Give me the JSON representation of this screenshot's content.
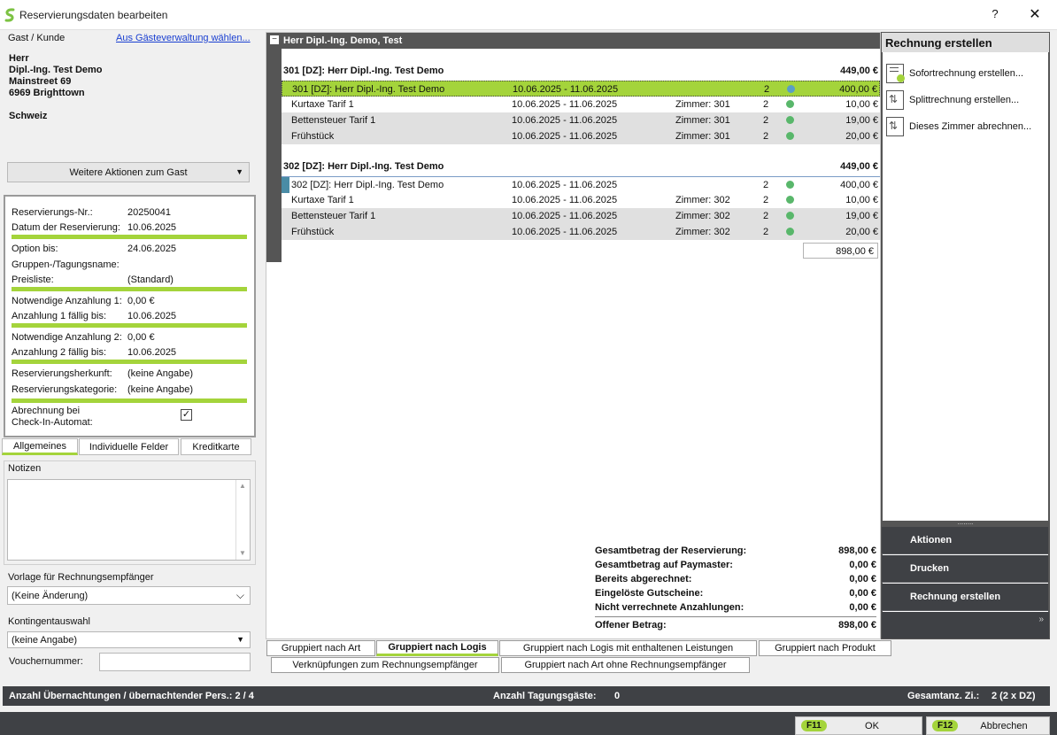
{
  "window": {
    "title": "Reservierungsdaten bearbeiten",
    "help": "?",
    "close": "✕"
  },
  "guest": {
    "section_label": "Gast / Kunde",
    "choose_link": "Aus Gästeverwaltung wählen...",
    "salutation": "Herr",
    "name": "Dipl.-Ing. Test Demo",
    "street": "Mainstreet 69",
    "city": "6969 Brighttown",
    "country": "Schweiz",
    "actions_button": "Weitere Aktionen zum Gast"
  },
  "reservation": {
    "fields": [
      {
        "label": "Reservierungs-Nr.:",
        "value": "20250041"
      },
      {
        "label": "Datum der Reservierung:",
        "value": "10.06.2025"
      },
      {
        "label": "Option bis:",
        "value": "24.06.2025"
      },
      {
        "label": "Gruppen-/Tagungsname:",
        "value": ""
      },
      {
        "label": "Preisliste:",
        "value": "(Standard)"
      },
      {
        "label": "Notwendige Anzahlung 1:",
        "value": "0,00 €"
      },
      {
        "label": "Anzahlung 1 fällig bis:",
        "value": "10.06.2025"
      },
      {
        "label": "Notwendige Anzahlung 2:",
        "value": "0,00 €"
      },
      {
        "label": "Anzahlung 2 fällig bis:",
        "value": "10.06.2025"
      },
      {
        "label": "Reservierungsherkunft:",
        "value": "(keine Angabe)"
      },
      {
        "label": "Reservierungskategorie:",
        "value": "(keine Angabe)"
      }
    ],
    "checkin_label_1": "Abrechnung bei",
    "checkin_label_2": "Check-In-Automat:",
    "checkin_checked": true
  },
  "left_tabs": [
    "Allgemeines",
    "Individuelle Felder",
    "Kreditkarte"
  ],
  "notes": {
    "label": "Notizen",
    "value": ""
  },
  "invoice_template": {
    "label": "Vorlage für Rechnungsempfänger",
    "value": "(Keine Änderung)"
  },
  "quota": {
    "label": "Kontingentauswahl",
    "value": "(keine Angabe)"
  },
  "voucher": {
    "label": "Vouchernummer:",
    "value": ""
  },
  "main": {
    "header": "Herr Dipl.-Ing. Demo, Test",
    "groups": [
      {
        "title": "301 [DZ]: Herr Dipl.-Ing. Test Demo",
        "total": "449,00 €",
        "rows": [
          {
            "name": "301 [DZ]: Herr Dipl.-Ing. Test Demo",
            "dates": "10.06.2025 - 11.06.2025",
            "room": "",
            "qty": "2",
            "amount": "400,00 €"
          },
          {
            "name": "Kurtaxe Tarif 1",
            "dates": "10.06.2025 - 11.06.2025",
            "room": "Zimmer: 301",
            "qty": "2",
            "amount": "10,00 €"
          },
          {
            "name": "Bettensteuer Tarif 1",
            "dates": "10.06.2025 - 11.06.2025",
            "room": "Zimmer: 301",
            "qty": "2",
            "amount": "19,00 €"
          },
          {
            "name": "Frühstück",
            "dates": "10.06.2025 - 11.06.2025",
            "room": "Zimmer: 301",
            "qty": "2",
            "amount": "20,00 €"
          }
        ]
      },
      {
        "title": "302 [DZ]: Herr Dipl.-Ing. Test Demo",
        "total": "449,00 €",
        "rows": [
          {
            "name": "302 [DZ]: Herr Dipl.-Ing. Test Demo",
            "dates": "10.06.2025 - 11.06.2025",
            "room": "",
            "qty": "2",
            "amount": "400,00 €"
          },
          {
            "name": "Kurtaxe Tarif 1",
            "dates": "10.06.2025 - 11.06.2025",
            "room": "Zimmer: 302",
            "qty": "2",
            "amount": "10,00 €"
          },
          {
            "name": "Bettensteuer Tarif 1",
            "dates": "10.06.2025 - 11.06.2025",
            "room": "Zimmer: 302",
            "qty": "2",
            "amount": "19,00 €"
          },
          {
            "name": "Frühstück",
            "dates": "10.06.2025 - 11.06.2025",
            "room": "Zimmer: 302",
            "qty": "2",
            "amount": "20,00 €"
          }
        ]
      }
    ],
    "grand_total": "898,00 €"
  },
  "summary": [
    {
      "label": "Gesamtbetrag der Reservierung:",
      "value": "898,00 €"
    },
    {
      "label": "Gesamtbetrag auf Paymaster:",
      "value": "0,00 €"
    },
    {
      "label": "Bereits abgerechnet:",
      "value": "0,00 €"
    },
    {
      "label": "Eingelöste Gutscheine:",
      "value": "0,00 €"
    },
    {
      "label": "Nicht verrechnete Anzahlungen:",
      "value": "0,00 €"
    },
    {
      "label": "Offener Betrag:",
      "value": "898,00 €"
    }
  ],
  "grouping_tabs": {
    "row1": [
      "Gruppiert nach Art",
      "Gruppiert nach Logis",
      "Gruppiert nach Logis mit enthaltenen Leistungen",
      "Gruppiert nach Produkt"
    ],
    "row2": [
      "Verknüpfungen zum Rechnungsempfänger",
      "Gruppiert nach Art ohne Rechnungsempfänger"
    ]
  },
  "right_panel": {
    "title": "Rechnung erstellen",
    "items": [
      "Sofortrechnung erstellen...",
      "Splittrechnung erstellen...",
      "Dieses Zimmer abrechnen..."
    ],
    "buttons": [
      "Aktionen",
      "Drucken",
      "Rechnung erstellen"
    ],
    "grip": "........",
    "more": "»"
  },
  "status": {
    "overnights": "Anzahl Übernachtungen / übernachtender Pers.: 2 / 4",
    "conference_label": "Anzahl Tagungsgäste:",
    "conference_value": "0",
    "rooms_label": "Gesamtanz. Zi.:",
    "rooms_value": "2 (2 x DZ)"
  },
  "footer": {
    "ok_key": "F11",
    "ok_label": "OK",
    "cancel_key": "F12",
    "cancel_label": "Abbrechen"
  },
  "colors": {
    "accent_green": "#a4d43b",
    "dark": "#3f4145",
    "status_dot": "#59b76b"
  }
}
